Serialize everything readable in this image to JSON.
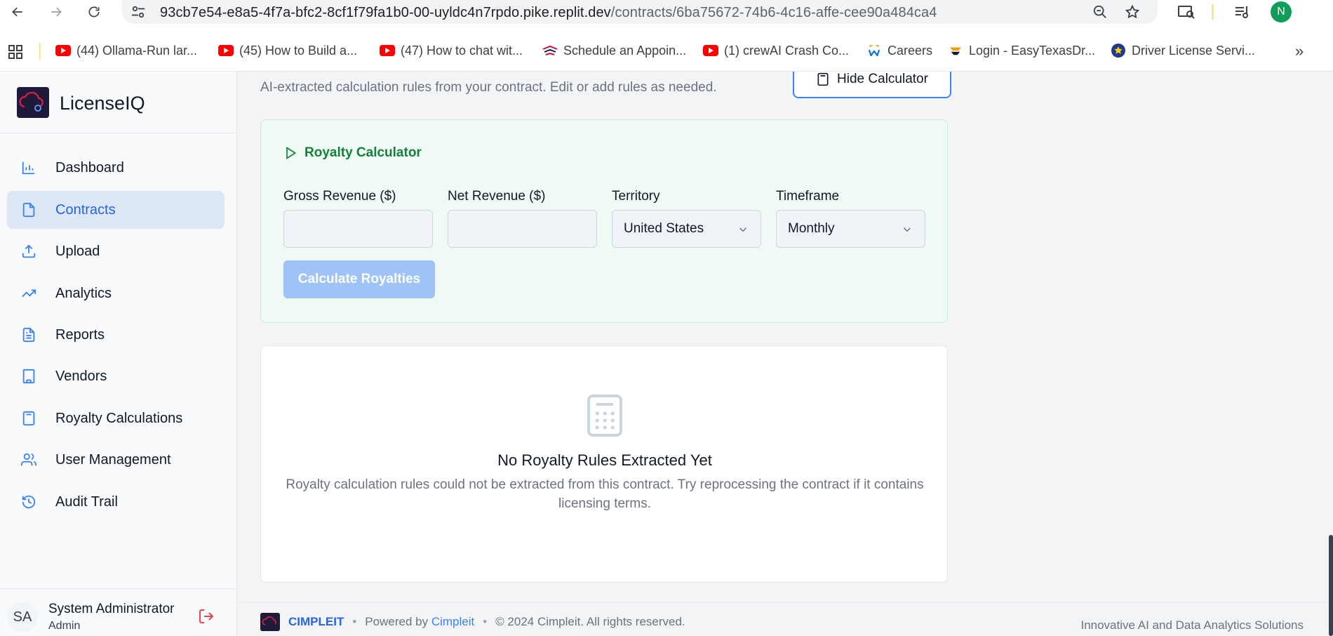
{
  "browser": {
    "url_host": "93cb7e54-e8a5-4f7a-bfc2-8cf1f79fa1b0-00-uyldc4n7rpdo.pike.replit.dev",
    "url_path": "/contracts/6ba75672-74b6-4c16-affe-cee90a484ca4",
    "profile_initial": "N",
    "bookmarks": [
      {
        "label": "(44) Ollama-Run lar...",
        "icon": "youtube-icon"
      },
      {
        "label": "(45) How to Build a...",
        "icon": "youtube-icon"
      },
      {
        "label": "(47) How to chat wit...",
        "icon": "youtube-icon"
      },
      {
        "label": "Schedule an Appoin...",
        "icon": "bank-of-america-icon"
      },
      {
        "label": "(1) crewAI Crash Co...",
        "icon": "youtube-icon"
      },
      {
        "label": "Careers",
        "icon": "workday-icon"
      },
      {
        "label": "Login - EasyTexasDr...",
        "icon": "easytexas-icon"
      },
      {
        "label": "Driver License Servi...",
        "icon": "texas-seal-icon"
      }
    ],
    "more_label": "»"
  },
  "app": {
    "brand_name": "LicenseIQ",
    "nav": [
      {
        "label": "Dashboard",
        "icon": "bar-chart-icon",
        "active": false
      },
      {
        "label": "Contracts",
        "icon": "file-icon",
        "active": true
      },
      {
        "label": "Upload",
        "icon": "upload-icon",
        "active": false
      },
      {
        "label": "Analytics",
        "icon": "trending-up-icon",
        "active": false
      },
      {
        "label": "Reports",
        "icon": "file-text-icon",
        "active": false
      },
      {
        "label": "Vendors",
        "icon": "building-icon",
        "active": false
      },
      {
        "label": "Royalty Calculations",
        "icon": "calculator-icon",
        "active": false
      },
      {
        "label": "User Management",
        "icon": "users-icon",
        "active": false
      },
      {
        "label": "Audit Trail",
        "icon": "history-icon",
        "active": false
      }
    ],
    "user": {
      "initials": "SA",
      "name": "System Administrator",
      "role": "Admin"
    }
  },
  "main": {
    "subtitle": "AI-extracted calculation rules from your contract. Edit or add rules as needed.",
    "hide_calculator_label": "Hide Calculator",
    "calculator": {
      "title": "Royalty Calculator",
      "gross_revenue_label": "Gross Revenue ($)",
      "gross_revenue_value": "",
      "net_revenue_label": "Net Revenue ($)",
      "net_revenue_value": "",
      "territory_label": "Territory",
      "territory_value": "United States",
      "timeframe_label": "Timeframe",
      "timeframe_value": "Monthly",
      "calculate_label": "Calculate Royalties"
    },
    "empty_state": {
      "title": "No Royalty Rules Extracted Yet",
      "text": "Royalty calculation rules could not be extracted from this contract. Try reprocessing the contract if it contains licensing terms."
    }
  },
  "footer": {
    "brand": "CIMPLEIT",
    "powered_by_prefix": "Powered by",
    "powered_by_link": "Cimpleit",
    "copyright": "© 2024 Cimpleit. All rights reserved.",
    "tagline": "Innovative AI and Data Analytics Solutions"
  },
  "colors": {
    "accent": "#2563eb",
    "calculator_bg": "#effaf5",
    "calculator_title": "#15803d",
    "button_disabled": "#9ec3f7",
    "active_nav_bg": "#dde8f6"
  }
}
